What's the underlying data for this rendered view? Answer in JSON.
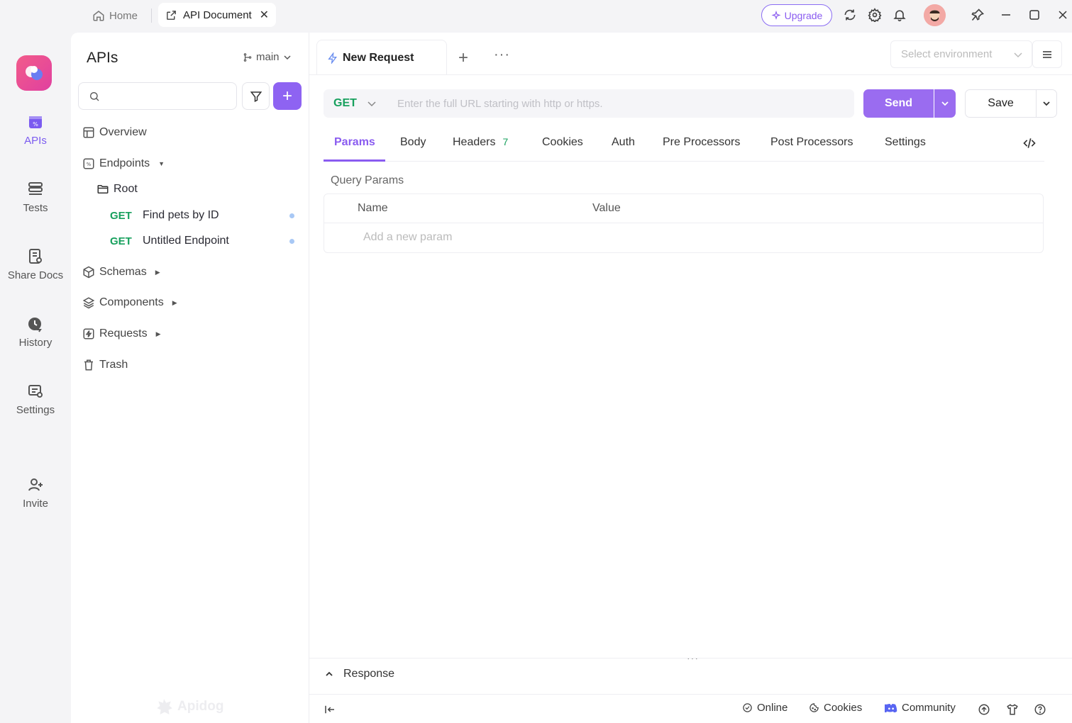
{
  "tabs": {
    "home_label": "Home",
    "api_label": "API Document",
    "close_symbol": "✕"
  },
  "topbar": {
    "upgrade_label": "Upgrade"
  },
  "rail": {
    "items": [
      {
        "label": "APIs",
        "icon": "apis-icon"
      },
      {
        "label": "Tests",
        "icon": "tests-icon"
      },
      {
        "label": "Share Docs",
        "icon": "share-docs-icon"
      },
      {
        "label": "History",
        "icon": "history-icon"
      },
      {
        "label": "Settings",
        "icon": "settings-icon"
      },
      {
        "label": "Invite",
        "icon": "invite-icon"
      }
    ]
  },
  "sidebar": {
    "title": "APIs",
    "branch": "main",
    "search_placeholder": "",
    "add_symbol": "+",
    "nav": {
      "overview": "Overview",
      "endpoints": "Endpoints",
      "root": "Root",
      "schemas": "Schemas",
      "components": "Components",
      "requests": "Requests",
      "trash": "Trash"
    },
    "endpoints": [
      {
        "method": "GET",
        "name": "Find pets by ID"
      },
      {
        "method": "GET",
        "name": "Untitled Endpoint"
      }
    ],
    "watermark": "Apidog"
  },
  "main": {
    "request_tab": "New Request",
    "tab_add": "+",
    "tab_more": "···",
    "env_placeholder": "Select environment",
    "url": {
      "method": "GET",
      "placeholder": "Enter the full URL starting with http or https.",
      "value": ""
    },
    "send_label": "Send",
    "save_label": "Save",
    "param_tabs": {
      "params": "Params",
      "body": "Body",
      "headers": "Headers",
      "headers_count": "7",
      "cookies": "Cookies",
      "auth": "Auth",
      "pre": "Pre Processors",
      "post": "Post Processors",
      "settings": "Settings"
    },
    "query_params": {
      "label": "Query Params",
      "col_name": "Name",
      "col_value": "Value",
      "add_placeholder": "Add a new param"
    },
    "resize_dots": "···",
    "response_label": "Response"
  },
  "footer": {
    "online": "Online",
    "cookies": "Cookies",
    "community": "Community"
  },
  "colors": {
    "accent": "#8a5cf0",
    "get": "#17a05d",
    "logo": "#f25b8a"
  }
}
